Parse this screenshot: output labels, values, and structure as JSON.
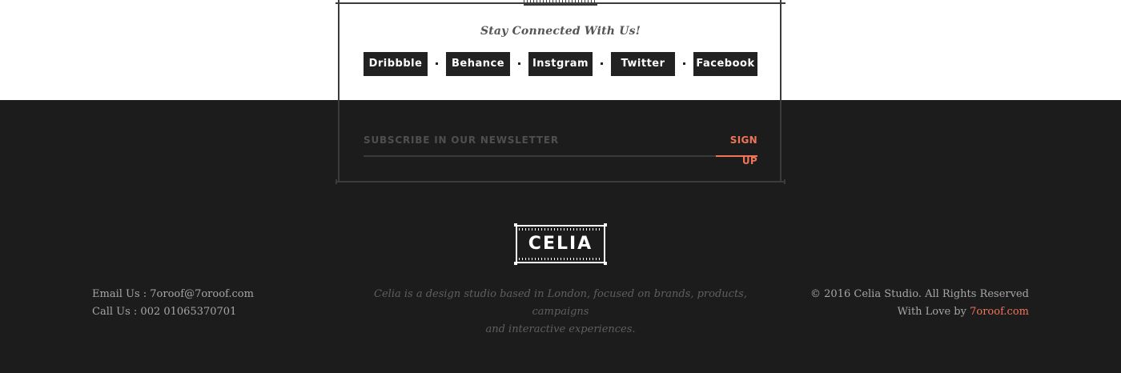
{
  "social": {
    "title": "Stay Connected With Us!",
    "buttons": [
      {
        "label": "Dribbble"
      },
      {
        "label": "Behance"
      },
      {
        "label": "Instgram"
      },
      {
        "label": "Twitter"
      },
      {
        "label": "Facebook"
      }
    ]
  },
  "newsletter": {
    "placeholder": "SUBSCRIBE IN OUR NEWSLETTER",
    "value": "",
    "signup_label": "SIGN UP"
  },
  "logo": {
    "text": "CELIA"
  },
  "footer": {
    "email_line": "Email Us : 7oroof@7oroof.com",
    "phone_line": "Call Us : 002 01065370701",
    "about_line1": "Celia is a design studio based in London, focused on brands, products, campaigns",
    "about_line2": "and interactive experiences.",
    "copyright": "© 2016 Celia Studio. All Rights Reserved",
    "credit_prefix": "With Love by ",
    "credit_link": "7oroof.com"
  },
  "colors": {
    "accent": "#f07558",
    "dark_bg": "#1c1c1c",
    "button_bg": "#222222"
  }
}
